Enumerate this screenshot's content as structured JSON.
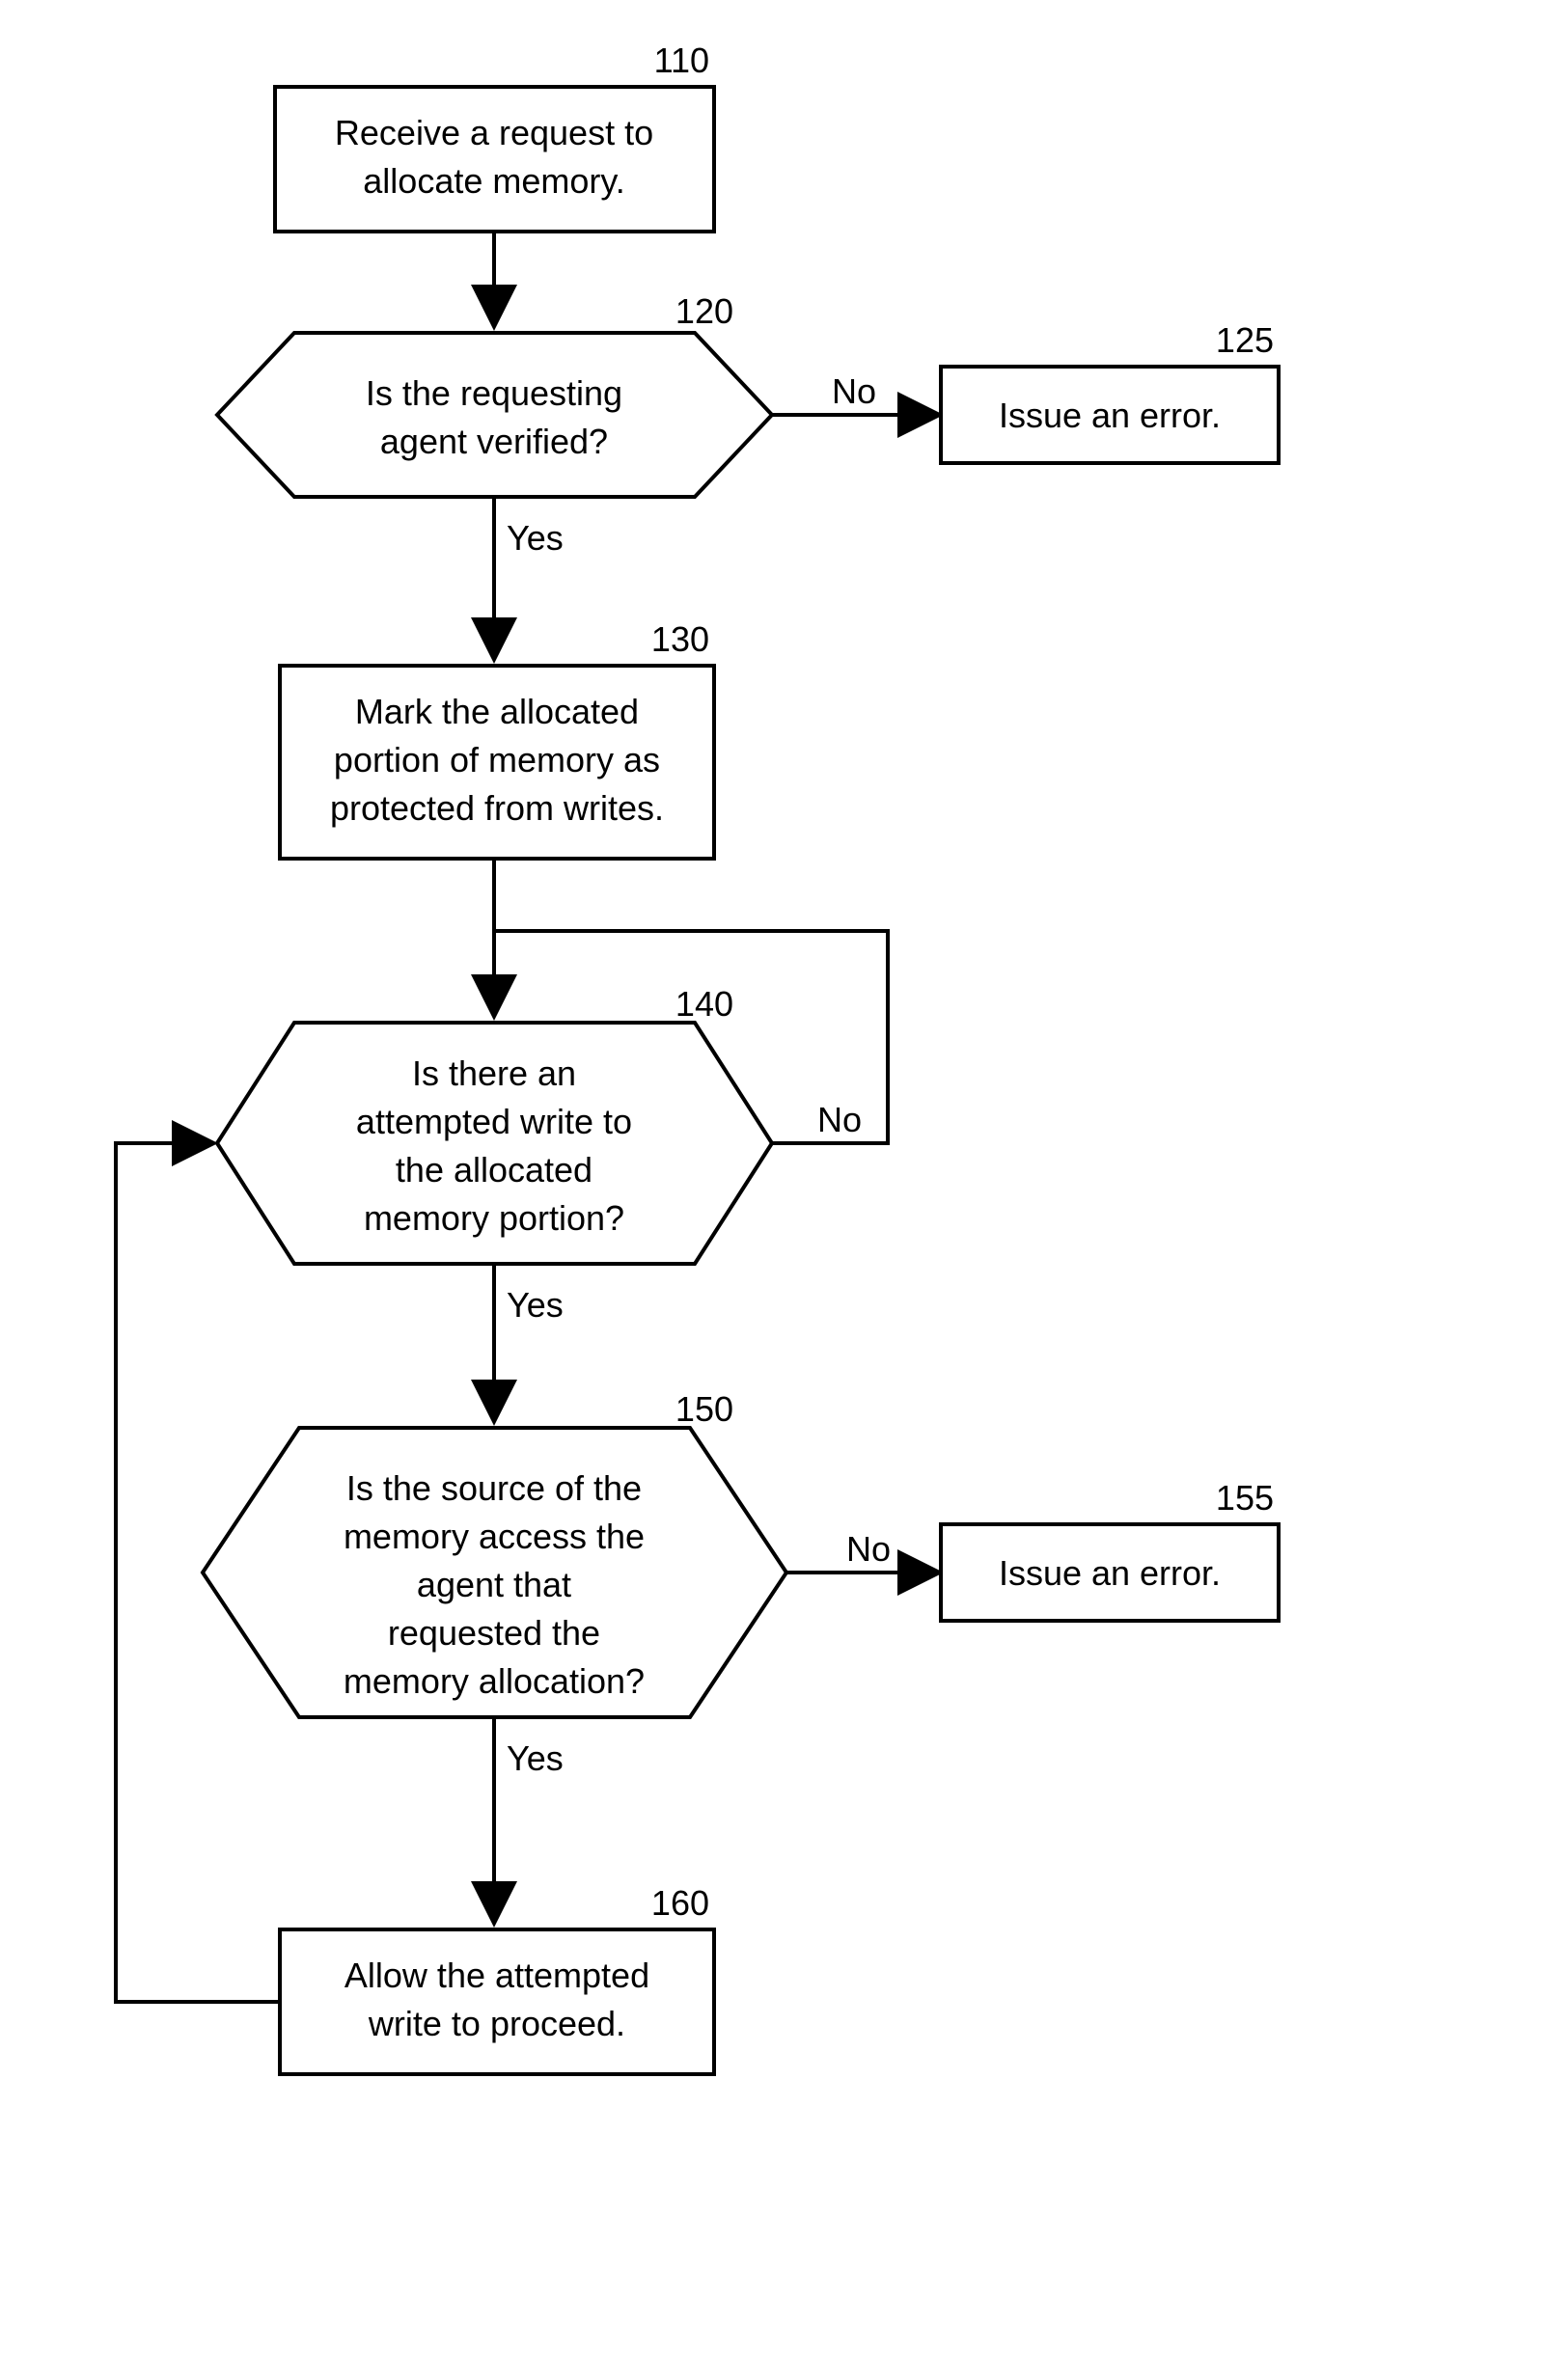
{
  "nodes": {
    "n110": {
      "num": "110",
      "lines": [
        "Receive a request to",
        "allocate memory."
      ]
    },
    "n120": {
      "num": "120",
      "lines": [
        "Is the requesting",
        "agent verified?"
      ]
    },
    "n125": {
      "num": "125",
      "lines": [
        "Issue an error."
      ]
    },
    "n130": {
      "num": "130",
      "lines": [
        "Mark the allocated",
        "portion of memory as",
        "protected from writes."
      ]
    },
    "n140": {
      "num": "140",
      "lines": [
        "Is there an",
        "attempted write to",
        "the allocated",
        "memory portion?"
      ]
    },
    "n150": {
      "num": "150",
      "lines": [
        "Is the source of the",
        "memory access the",
        "agent that",
        "requested the",
        "memory allocation?"
      ]
    },
    "n155": {
      "num": "155",
      "lines": [
        "Issue an error."
      ]
    },
    "n160": {
      "num": "160",
      "lines": [
        "Allow the attempted",
        "write to proceed."
      ]
    }
  },
  "edges": {
    "yes": "Yes",
    "no": "No"
  }
}
